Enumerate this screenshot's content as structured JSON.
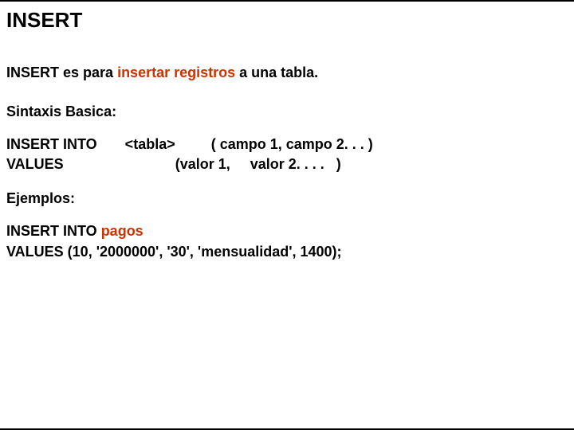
{
  "title": "INSERT",
  "intro": {
    "prefix": "INSERT es para ",
    "highlight": "insertar registros",
    "suffix": " a una tabla."
  },
  "syntax_label": "Sintaxis Basica:",
  "syntax": {
    "row1": "INSERT INTO       <tabla>         ( campo 1, campo 2. . . )",
    "row2": "VALUES                            (valor 1,     valor 2. . . .   )"
  },
  "examples_label": "Ejemplos:",
  "example": {
    "line1_prefix": "INSERT INTO ",
    "line1_highlight": "pagos",
    "line2": "VALUES (10, '2000000', '30', 'mensualidad', 1400);"
  }
}
